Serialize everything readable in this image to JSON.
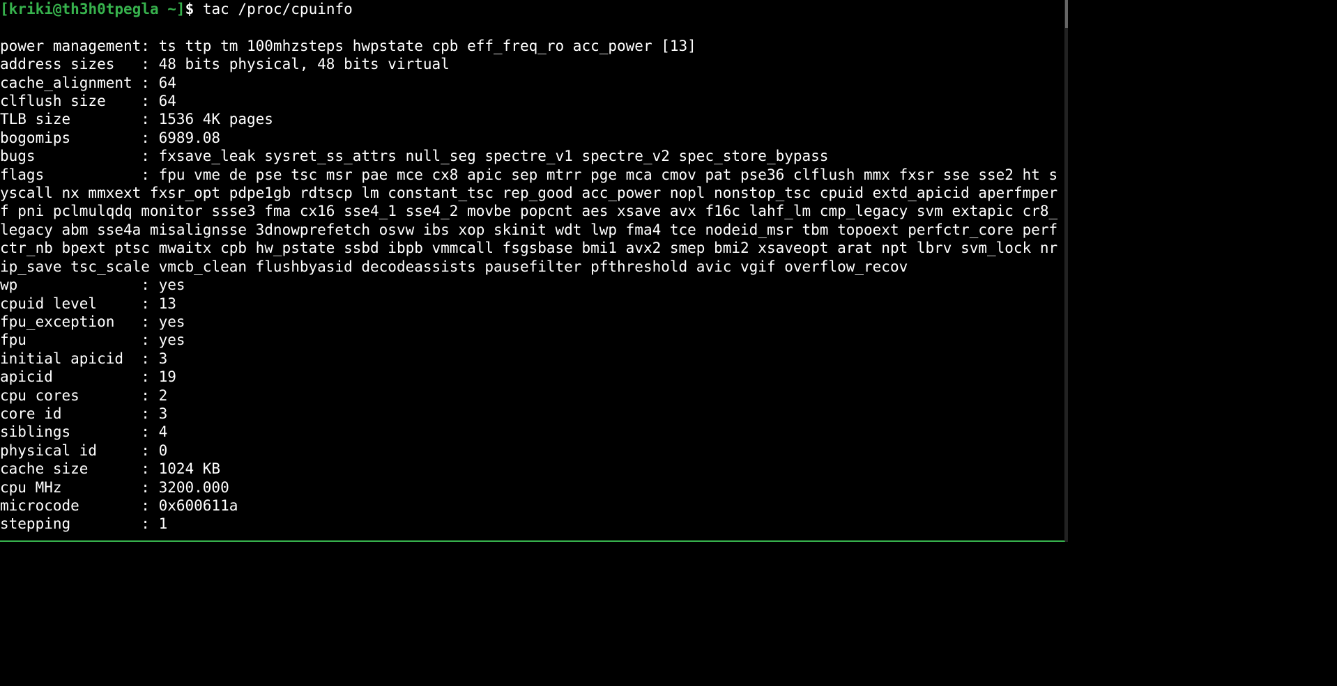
{
  "prompt": {
    "open": "[",
    "user": "kriki",
    "sep": "@",
    "host": "th3h0tpegla",
    "path": " ~",
    "close": "]",
    "dollar": "$ "
  },
  "command": "tac /proc/cpuinfo",
  "lines": [
    "",
    "power management: ts ttp tm 100mhzsteps hwpstate cpb eff_freq_ro acc_power [13]",
    "address sizes   : 48 bits physical, 48 bits virtual",
    "cache_alignment : 64",
    "clflush size    : 64",
    "TLB size        : 1536 4K pages",
    "bogomips        : 6989.08",
    "bugs            : fxsave_leak sysret_ss_attrs null_seg spectre_v1 spectre_v2 spec_store_bypass",
    "flags           : fpu vme de pse tsc msr pae mce cx8 apic sep mtrr pge mca cmov pat pse36 clflush mmx fxsr sse sse2 ht syscall nx mmxext fxsr_opt pdpe1gb rdtscp lm constant_tsc rep_good acc_power nopl nonstop_tsc cpuid extd_apicid aperfmperf pni pclmulqdq monitor ssse3 fma cx16 sse4_1 sse4_2 movbe popcnt aes xsave avx f16c lahf_lm cmp_legacy svm extapic cr8_legacy abm sse4a misalignsse 3dnowprefetch osvw ibs xop skinit wdt lwp fma4 tce nodeid_msr tbm topoext perfctr_core perfctr_nb bpext ptsc mwaitx cpb hw_pstate ssbd ibpb vmmcall fsgsbase bmi1 avx2 smep bmi2 xsaveopt arat npt lbrv svm_lock nrip_save tsc_scale vmcb_clean flushbyasid decodeassists pausefilter pfthreshold avic vgif overflow_recov",
    "wp              : yes",
    "cpuid level     : 13",
    "fpu_exception   : yes",
    "fpu             : yes",
    "initial apicid  : 3",
    "apicid          : 19",
    "cpu cores       : 2",
    "core id         : 3",
    "siblings        : 4",
    "physical id     : 0",
    "cache size      : 1024 KB",
    "cpu MHz         : 3200.000",
    "microcode       : 0x600611a",
    "stepping        : 1"
  ]
}
